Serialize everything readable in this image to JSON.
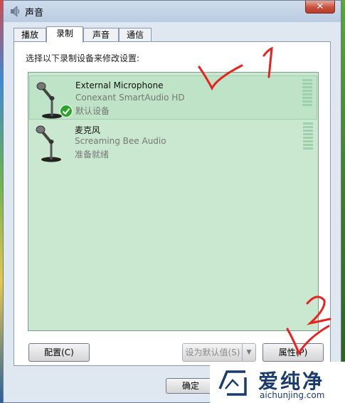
{
  "window": {
    "title": "声音",
    "close_label": "✕"
  },
  "tabs": [
    {
      "label": "播放",
      "active": false
    },
    {
      "label": "录制",
      "active": true
    },
    {
      "label": "声音",
      "active": false
    },
    {
      "label": "通信",
      "active": false
    }
  ],
  "panel": {
    "instruction": "选择以下录制设备来修改设置:"
  },
  "devices": [
    {
      "name": "External Microphone",
      "driver": "Conexant SmartAudio HD",
      "status": "默认设备",
      "default": true,
      "selected": true
    },
    {
      "name": "麦克风",
      "driver": "Screaming Bee Audio",
      "status": "准备就绪",
      "default": false,
      "selected": false
    }
  ],
  "buttons": {
    "configure": "配置(C)",
    "set_default": "设为默认值(S)",
    "properties": "属性(P)",
    "ok": "确定"
  },
  "annotations": {
    "mark1": "1",
    "mark2": "2"
  },
  "watermark": {
    "brand": "爱纯净",
    "url": "aichunjing.com"
  },
  "colors": {
    "list_bg": "#c9e8cf",
    "annotation": "#e8231f",
    "check": "#2aa52a"
  }
}
